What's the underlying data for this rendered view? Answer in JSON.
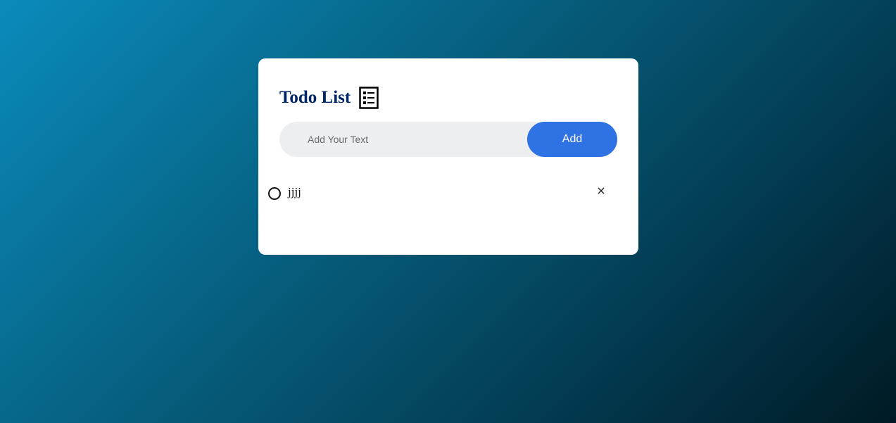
{
  "app": {
    "title": "Todo List",
    "title_icon": "checklist-icon"
  },
  "input": {
    "value": "",
    "placeholder": "Add Your Text"
  },
  "add_button": {
    "label": "Add"
  },
  "todos": [
    {
      "text": "jjjj",
      "checked": false,
      "check_icon": "circle-icon",
      "delete_icon": "close-icon"
    }
  ],
  "colors": {
    "title": "#002765",
    "accent": "#2f72e3",
    "input_bg": "#edeef0",
    "card_bg": "#ffffff"
  }
}
